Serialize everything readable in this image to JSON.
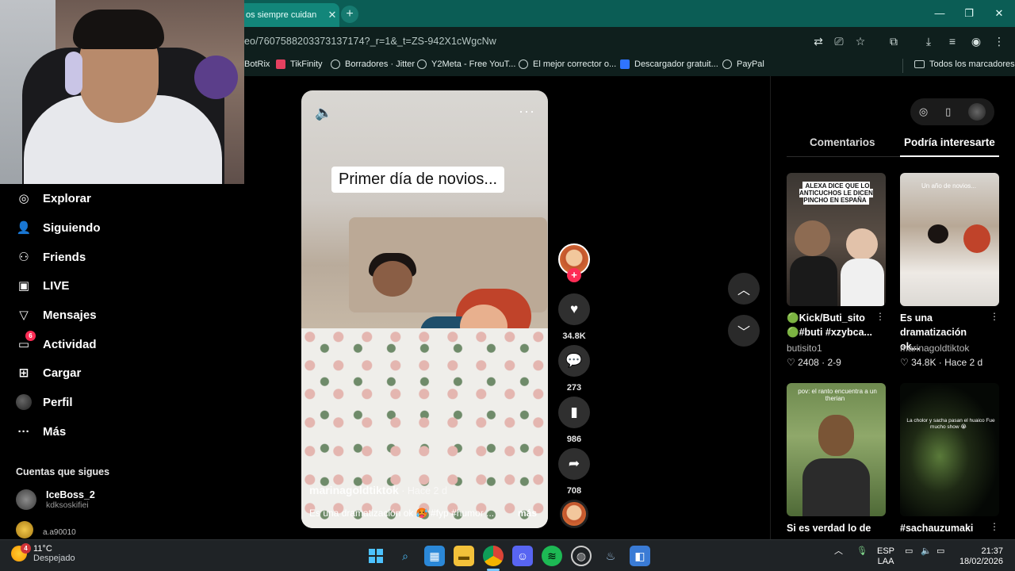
{
  "browser": {
    "tab_title": "os siempre cuidan",
    "tab_close": "✕",
    "new_tab": "+",
    "url": "eo/7607588203373137174?_r=1&_t=ZS-942X1cWgcNw",
    "window_controls": {
      "minimize": "—",
      "maximize": "❐",
      "close": "✕"
    },
    "bookmarks": [
      {
        "label": "BotRix"
      },
      {
        "label": "TikFinity"
      },
      {
        "label": "Borradores · Jitter"
      },
      {
        "label": "Y2Meta - Free YouT..."
      },
      {
        "label": "El mejor corrector o..."
      },
      {
        "label": "Descargador gratuit..."
      },
      {
        "label": "PayPal"
      }
    ],
    "all_bookmarks": "Todos los marcadores"
  },
  "sidebar": {
    "items": [
      {
        "label": "Explorar",
        "icon": "compass-icon"
      },
      {
        "label": "Siguiendo",
        "icon": "user-follow-icon"
      },
      {
        "label": "Friends",
        "icon": "friends-icon"
      },
      {
        "label": "LIVE",
        "icon": "live-tv-icon"
      },
      {
        "label": "Mensajes",
        "icon": "send-icon"
      },
      {
        "label": "Actividad",
        "icon": "inbox-icon",
        "badge": "6"
      },
      {
        "label": "Cargar",
        "icon": "upload-plus-icon"
      },
      {
        "label": "Perfil",
        "icon": "avatar"
      },
      {
        "label": "Más",
        "icon": "ellipsis-icon"
      }
    ],
    "following_title": "Cuentas que sigues",
    "following": [
      {
        "name": "IceBoss_2",
        "handle": "kdksoskifiei"
      },
      {
        "name": "a.a90010",
        "handle": ""
      }
    ]
  },
  "video": {
    "caption_overlay": "Primer día de novios...",
    "author": "marinagoldtiktok",
    "posted": " · Hace 2 d",
    "description": "Es una dramatización ok 🥵 #fyp #humor ...",
    "more_label": "más",
    "actions": {
      "likes": "34.8K",
      "comments": "273",
      "saves": "986",
      "shares": "708"
    },
    "follow_plus": "+"
  },
  "right_panel": {
    "tabs": [
      "Comentarios",
      "Podría interesarte"
    ],
    "active_tab": "Podría interesarte",
    "recommendations": [
      {
        "thumb_text": "ALEXA DICE QUE LO ANTICUCHOS LE DICEN PINCHO EN ESPAÑA",
        "title": "🟢Kick/Buti_sito 🟢#buti #xzybca...",
        "author": "butisito1",
        "likes": "2408",
        "when": "2-9"
      },
      {
        "thumb_text": "Un año de novios...",
        "title": "Es una dramatización ok...",
        "author": "marinagoldtiktok",
        "likes": "34.8K",
        "when": "Hace 2 d"
      },
      {
        "thumb_text": "pov: el ranto encuentra a un therian",
        "title": "Si es verdad lo de",
        "author": "",
        "likes": "",
        "when": ""
      },
      {
        "thumb_text": "La cholor y sacha pasan el huaico Fue mucho show 😭",
        "title": "#sachauzumaki",
        "author": "",
        "likes": "",
        "when": ""
      }
    ]
  },
  "taskbar": {
    "weather_temp": "11°C",
    "weather_desc": "Despejado",
    "weather_badge": "4",
    "lang": "ESP",
    "lang2": "LAA",
    "time": "21:37",
    "date": "18/02/2026"
  }
}
